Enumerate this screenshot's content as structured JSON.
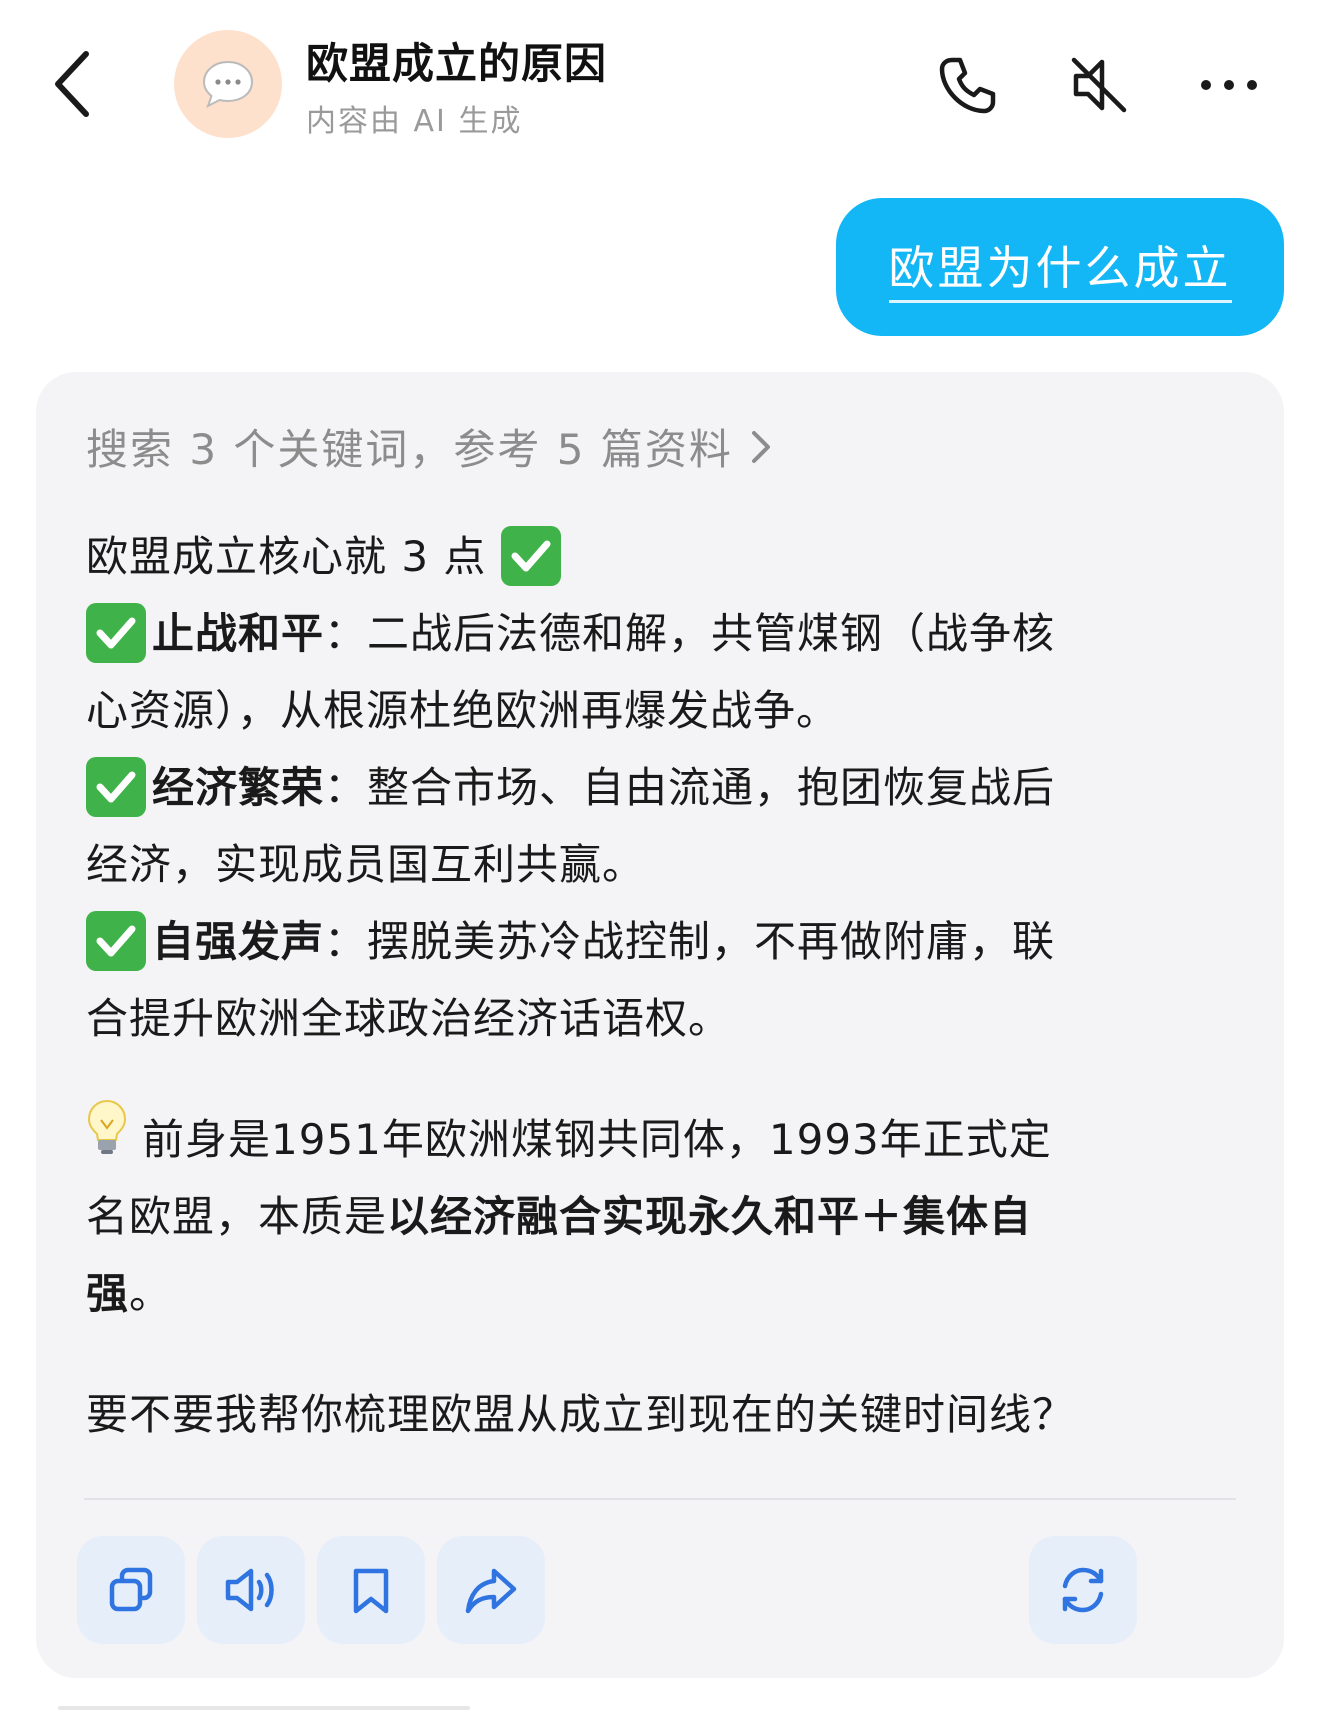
{
  "header": {
    "title": "欧盟成立的原因",
    "subtitle": "内容由 AI 生成",
    "avatar_icon": "chat-bubble-icon",
    "actions": [
      "phone-icon",
      "mute-icon",
      "more-icon"
    ]
  },
  "user_message": "欧盟为什么成立",
  "answer": {
    "search_summary": "搜索 3 个关键词，参考 5 篇资料",
    "intro": "欧盟成立核心就 3 点",
    "points": [
      {
        "title": "止战和平",
        "colon": "：",
        "line1_rest": "二战后法德和解，共管煤钢（战争核",
        "line2": "心资源），从根源杜绝欧洲再爆发战争。"
      },
      {
        "title": "经济繁荣",
        "colon": "：",
        "line1_rest": "整合市场、自由流通，抱团恢复战后",
        "line2": "经济，实现成员国互利共赢。"
      },
      {
        "title": "自强发声",
        "colon": "：",
        "line1_rest": "摆脱美苏冷战控制，不再做附庸，联",
        "line2": "合提升欧洲全球政治经济话语权。"
      }
    ],
    "note": {
      "line1": "前身是1951年欧洲煤钢共同体，1993年正式定",
      "line2_plain": "名欧盟，本质是",
      "line2_bold": "以经济融合实现永久和平＋集体自",
      "line3_bold": "强",
      "line3_plain": "。"
    },
    "question": "要不要我帮你梳理欧盟从成立到现在的关键时间线？"
  },
  "actions": [
    "copy-icon",
    "speaker-icon",
    "bookmark-icon",
    "share-icon",
    "regenerate-icon"
  ],
  "colors": {
    "accent": "#14b7f5",
    "card_bg": "#f4f4f6",
    "icon_blue": "#2f74e0",
    "check_green": "#3fb24a",
    "avatar_bg": "#fde1cc"
  }
}
